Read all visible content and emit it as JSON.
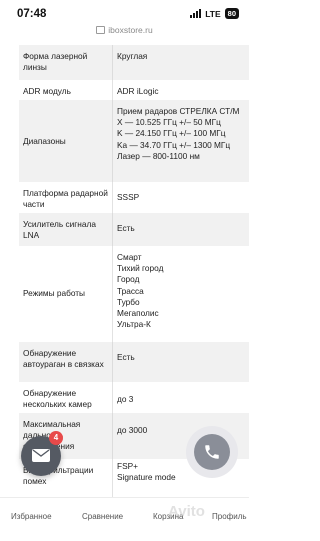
{
  "status_bar": {
    "time": "07:48",
    "network": "LTE",
    "battery": "80"
  },
  "browser": {
    "url": "iboxstore.ru"
  },
  "specs": [
    {
      "key": "Форма лазерной линзы",
      "value": "Круглая"
    },
    {
      "key": "ADR модуль",
      "value": "ADR iLogic"
    },
    {
      "key": "Диапазоны",
      "value": "Прием радаров СТРЕЛКА СТ/М\nX — 10.525 ГГц +/– 50 МГц\nK — 24.150 ГГц +/– 100 МГц\nKa — 34.70 ГГц +/– 1300 МГц\nЛазер — 800-1100 нм"
    },
    {
      "key": "Платформа радарной части",
      "value": "SSSP"
    },
    {
      "key": "Усилитель сигнала LNA",
      "value": "Есть"
    },
    {
      "key": "Режимы работы",
      "value": "Смарт\nТихий город\nГород\nТрасса\nТурбо\nМегаполис\nУльтра-К"
    },
    {
      "key": "Обнаружение автоураган в связках",
      "value": "Есть"
    },
    {
      "key": "Обнаружение нескольких камер",
      "value": "до 3"
    },
    {
      "key": "Максимальная дальность обнаружения",
      "value": "до 3000"
    },
    {
      "key": "Виды фильтрации помех",
      "value": "FSP+\nSignature mode"
    }
  ],
  "chat": {
    "badge_count": "4"
  },
  "bottom_nav": {
    "favorites": "Избранное",
    "compare": "Сравнение",
    "cart": "Корзина",
    "profile": "Профиль"
  },
  "watermark": "Avito"
}
